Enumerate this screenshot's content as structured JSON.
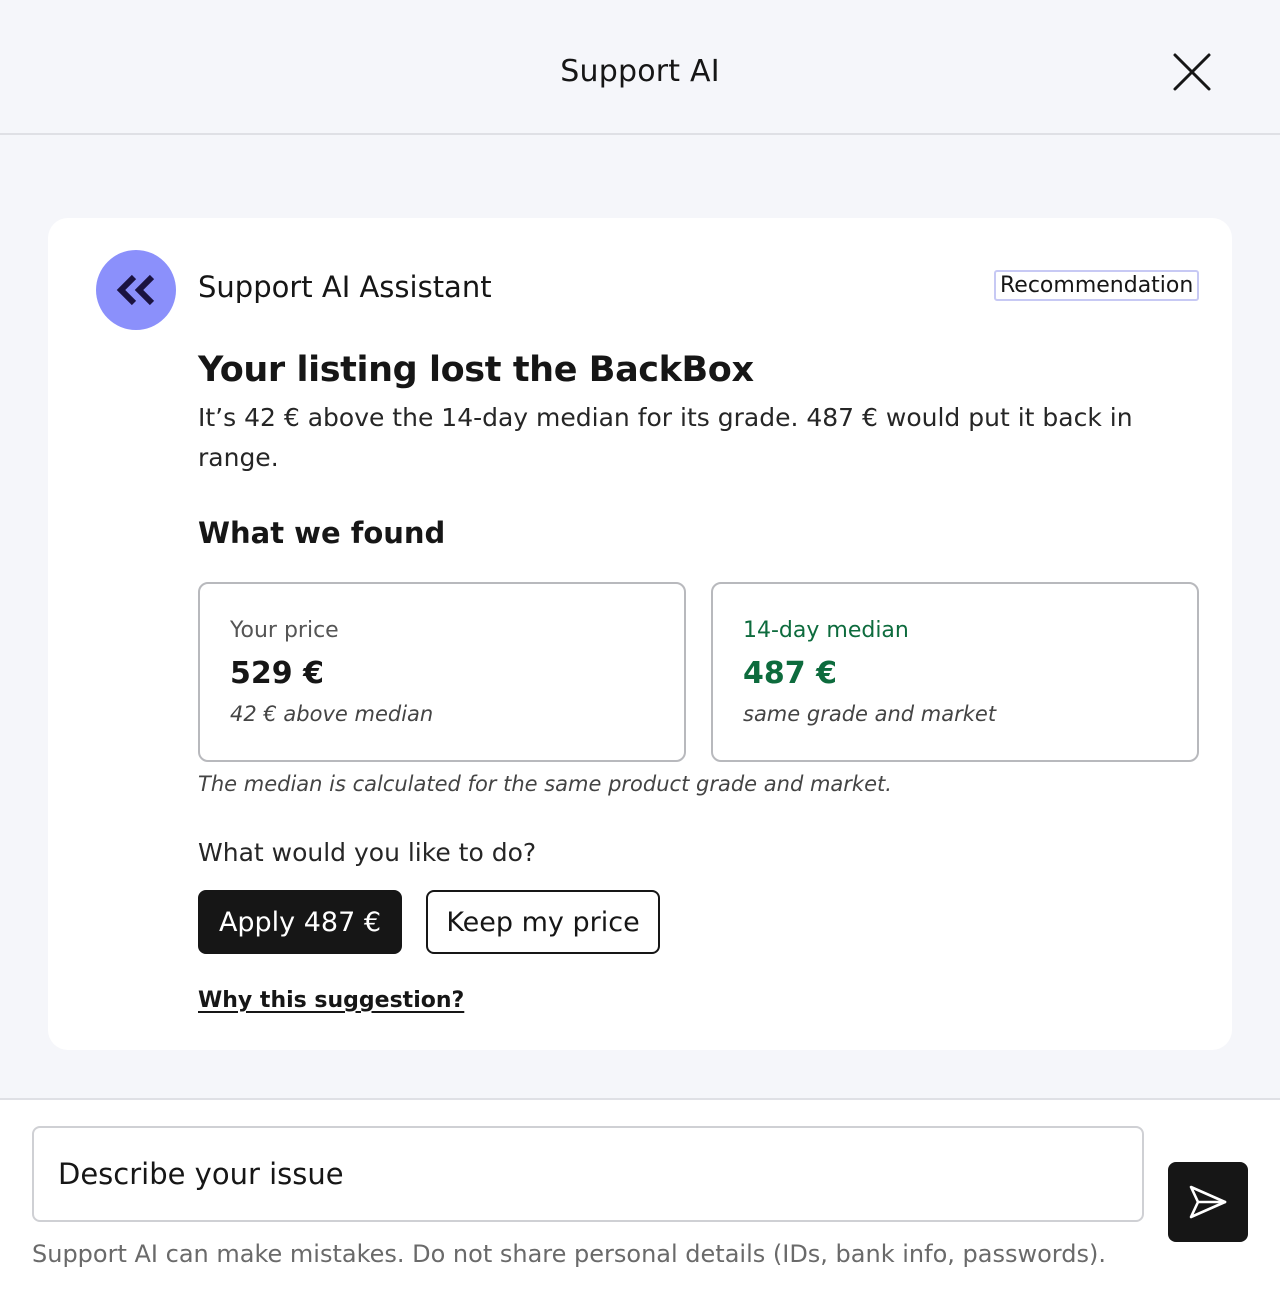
{
  "header": {
    "title": "Support AI",
    "close_icon": "close-icon"
  },
  "card": {
    "assistant_name": "Support AI Assistant",
    "avatar_icon": "double-chevron-left-icon",
    "badge": "Recommendation",
    "headline": "Your listing lost the BackBox",
    "summary": "It’s 42 € above the 14-day median for its grade. 487 € would put it back in range.",
    "section_title": "What we found",
    "stats": [
      {
        "label": "Your price",
        "value": "529 €",
        "note": "42 € above median"
      },
      {
        "label": "14-day median",
        "value": "487 €",
        "note": "same grade and market"
      }
    ],
    "footnote": "The median is calculated for the same product grade and market.",
    "question": "What would you like to do?",
    "primary_button": "Apply 487 €",
    "secondary_button": "Keep my price",
    "link": "Why this suggestion?"
  },
  "composer": {
    "placeholder": "Describe your issue",
    "send_icon": "send-icon",
    "disclaimer": "Support AI can make mistakes. Do not share personal details (IDs, bank info, passwords)."
  },
  "colors": {
    "accent": "#8b90fb",
    "positive": "#0d6b3d",
    "dark": "#161616",
    "background": "#f5f6fa"
  }
}
